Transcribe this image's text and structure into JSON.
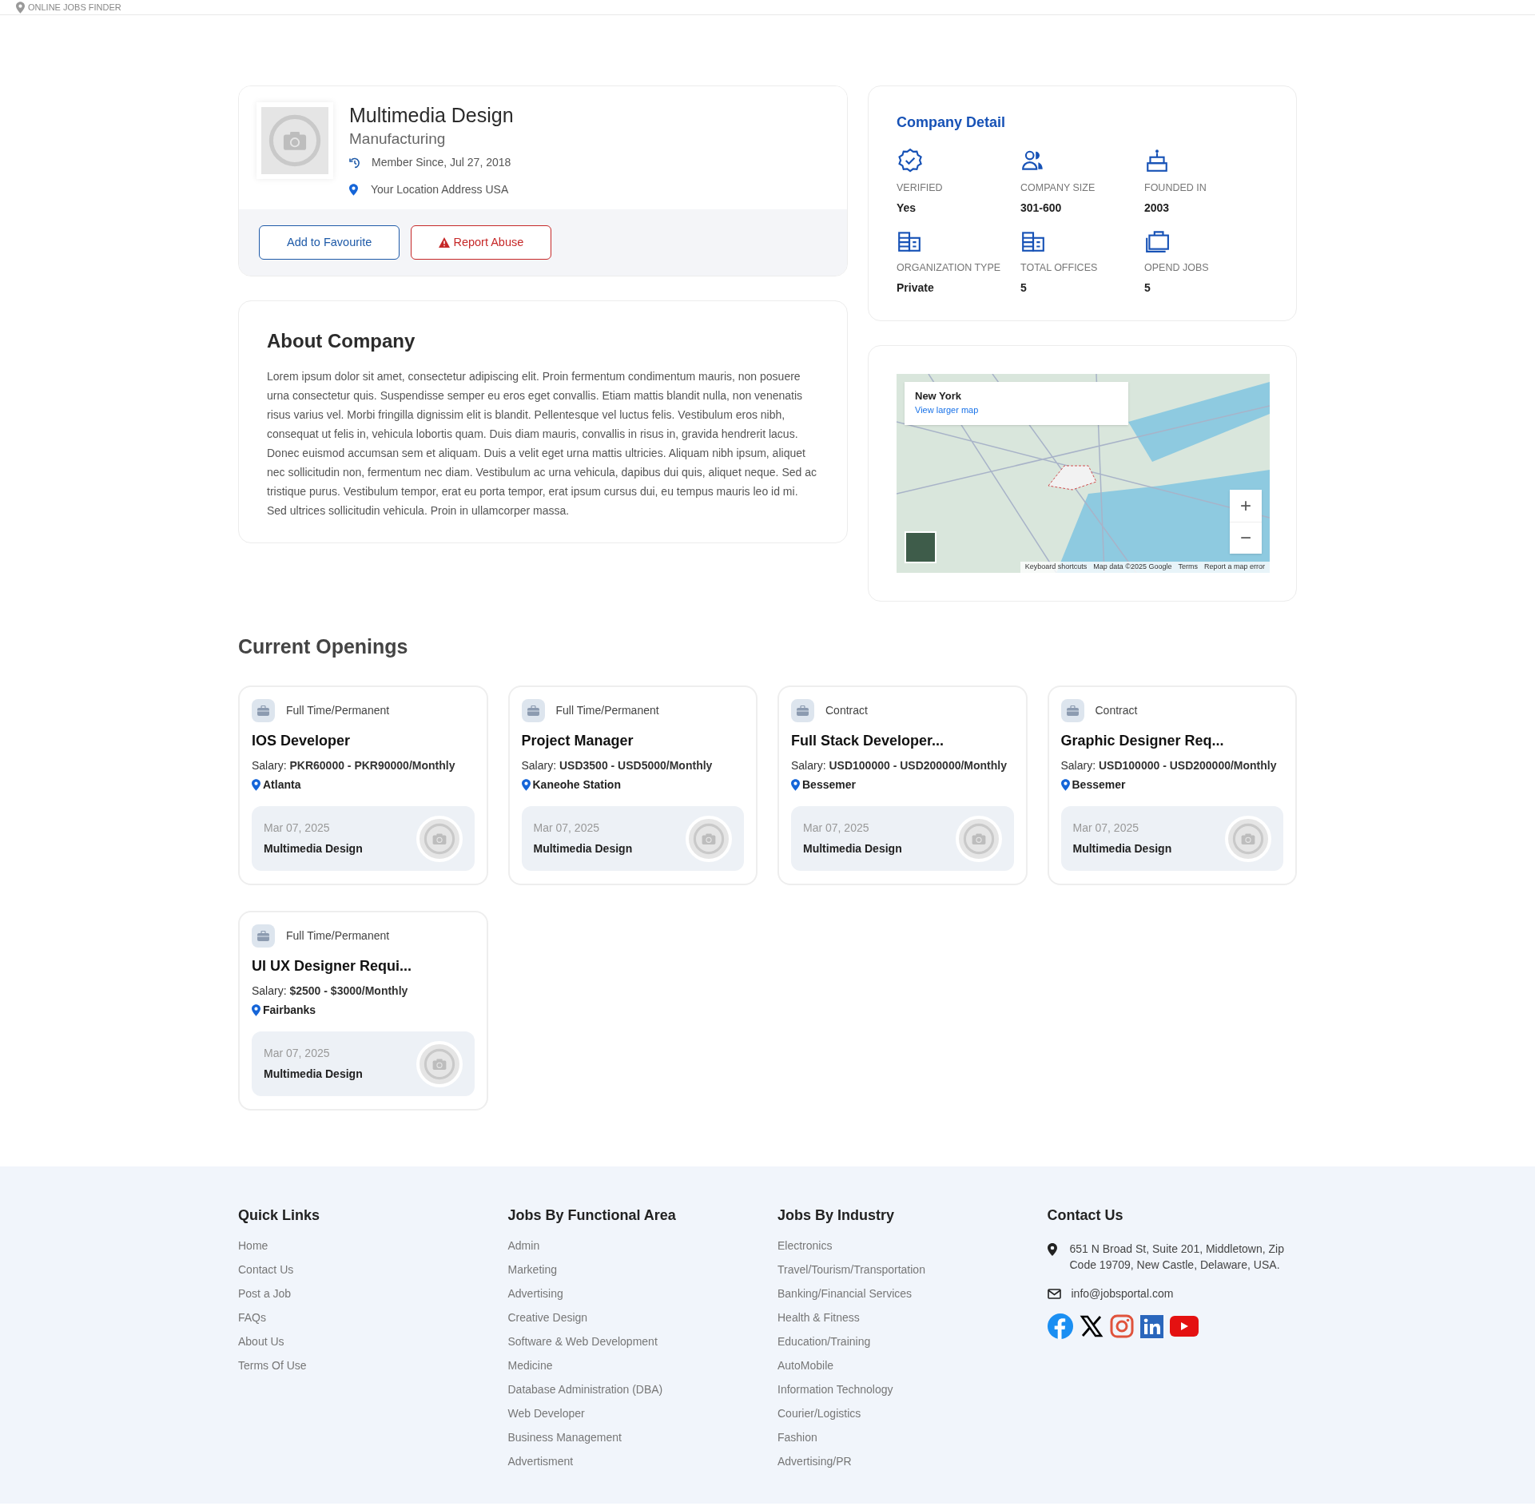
{
  "top_bar": {
    "brand": "ONLINE JOBS FINDER"
  },
  "company": {
    "name": "Multimedia Design",
    "industry": "Manufacturing",
    "member_since": "Member Since, Jul 27, 2018",
    "location": "Your Location Address USA",
    "buttons": [
      {
        "kind": "favourite",
        "label": "Add to Favourite"
      },
      {
        "kind": "report",
        "label": "Report Abuse"
      }
    ]
  },
  "about": {
    "title": "About Company",
    "text": "Lorem ipsum dolor sit amet, consectetur adipiscing elit. Proin fermentum condimentum mauris, non posuere urna consectetur quis. Suspendisse semper eu eros eget convallis. Etiam mattis blandit nulla, non venenatis risus varius vel. Morbi fringilla dignissim elit is blandit. Pellentesque vel luctus felis. Vestibulum eros nibh, consequat ut felis in, vehicula lobortis quam. Duis diam mauris, convallis in risus in, gravida hendrerit lacus. Donec euismod accumsan sem et aliquam. Duis a velit eget urna mattis ultricies. Aliquam nibh ipsum, aliquet nec sollicitudin non, fermentum nec diam. Vestibulum ac urna vehicula, dapibus dui quis, aliquet neque. Sed ac tristique purus. Vestibulum tempor, erat eu porta tempor, erat ipsum cursus dui, eu tempus mauris leo id mi. Sed ultrices sollicitudin vehicula. Proin in ullamcorper massa."
  },
  "company_detail": {
    "title": "Company Detail",
    "items": [
      {
        "kind": "verified",
        "label": "VERIFIED",
        "value": "Yes"
      },
      {
        "kind": "size",
        "label": "COMPANY SIZE",
        "value": "301-600"
      },
      {
        "kind": "founded",
        "label": "FOUNDED IN",
        "value": "2003"
      },
      {
        "kind": "org",
        "label": "ORGANIZATION TYPE",
        "value": "Private"
      },
      {
        "kind": "offices",
        "label": "TOTAL OFFICES",
        "value": "5"
      },
      {
        "kind": "jobs",
        "label": "OPEND JOBS",
        "value": "5"
      }
    ]
  },
  "map": {
    "place": "New York",
    "link": "View larger map",
    "zoom_in": "+",
    "zoom_out": "−",
    "attribution": [
      "Keyboard shortcuts",
      "Map data ©2025 Google",
      "Terms",
      "Report a map error"
    ]
  },
  "openings": {
    "title": "Current Openings",
    "jobs": [
      {
        "type": "Full Time/Permanent",
        "title": "IOS Developer",
        "salary_label": "Salary:",
        "salary": "PKR60000 - PKR90000/Monthly",
        "city": "Atlanta",
        "date": "Mar 07, 2025",
        "company": "Multimedia Design"
      },
      {
        "type": "Full Time/Permanent",
        "title": "Project Manager",
        "salary_label": "Salary:",
        "salary": "USD3500 - USD5000/Monthly",
        "city": "Kaneohe Station",
        "date": "Mar 07, 2025",
        "company": "Multimedia Design"
      },
      {
        "type": "Contract",
        "title": "Full Stack Developer...",
        "salary_label": "Salary:",
        "salary": "USD100000 - USD200000/Monthly",
        "city": "Bessemer",
        "date": "Mar 07, 2025",
        "company": "Multimedia Design"
      },
      {
        "type": "Contract",
        "title": "Graphic Designer Req...",
        "salary_label": "Salary:",
        "salary": "USD100000 - USD200000/Monthly",
        "city": "Bessemer",
        "date": "Mar 07, 2025",
        "company": "Multimedia Design"
      },
      {
        "type": "Full Time/Permanent",
        "title": "UI UX Designer Requi...",
        "salary_label": "Salary:",
        "salary": "$2500 - $3000/Monthly",
        "city": "Fairbanks",
        "date": "Mar 07, 2025",
        "company": "Multimedia Design"
      }
    ]
  },
  "footer": {
    "columns": [
      {
        "title": "Quick Links",
        "links": [
          "Home",
          "Contact Us",
          "Post a Job",
          "FAQs",
          "About Us",
          "Terms Of Use"
        ]
      },
      {
        "title": "Jobs By Functional Area",
        "links": [
          "Admin",
          "Marketing",
          "Advertising",
          "Creative Design",
          "Software & Web Development",
          "Medicine",
          "Database Administration (DBA)",
          "Web Developer",
          "Business Management",
          "Advertisment"
        ]
      },
      {
        "title": "Jobs By Industry",
        "links": [
          "Electronics",
          "Travel/Tourism/Transportation",
          "Banking/Financial Services",
          "Health & Fitness",
          "Education/Training",
          "AutoMobile",
          "Information Technology",
          "Courier/Logistics",
          "Fashion",
          "Advertising/PR"
        ]
      }
    ],
    "contact": {
      "title": "Contact Us",
      "address": "651 N Broad St, Suite 201, Middletown, Zip Code 19709, New Castle, Delaware, USA.",
      "email": "info@jobsportal.com",
      "socials": [
        {
          "kind": "facebook"
        },
        {
          "kind": "x"
        },
        {
          "kind": "instagram"
        },
        {
          "kind": "linkedin"
        },
        {
          "kind": "youtube"
        }
      ]
    }
  }
}
